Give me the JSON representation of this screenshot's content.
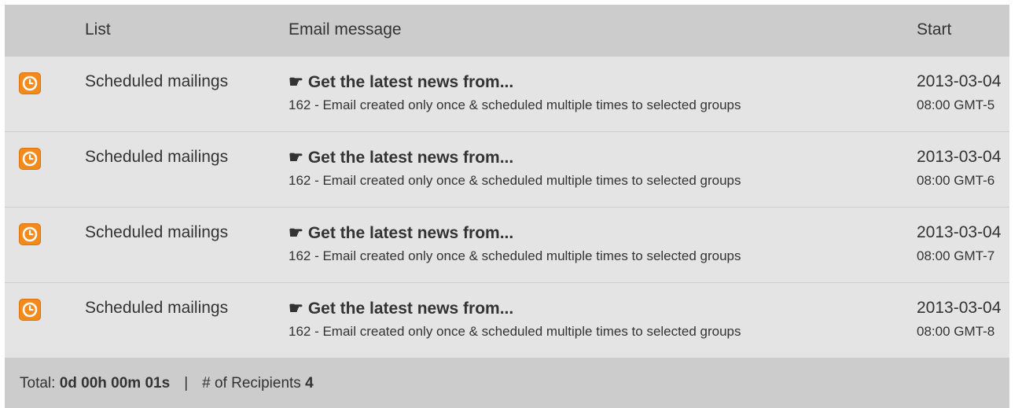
{
  "header": {
    "list": "List",
    "email_message": "Email message",
    "start": "Start"
  },
  "rows": [
    {
      "icon": "clock-icon",
      "list": "Scheduled mailings",
      "title_glyph": "☛",
      "title": "Get the latest news from...",
      "subtitle": "162 - Email created only once & scheduled multiple times to selected groups",
      "start_date": "2013-03-04",
      "start_time": "08:00 GMT-5"
    },
    {
      "icon": "clock-icon",
      "list": "Scheduled mailings",
      "title_glyph": "☛",
      "title": "Get the latest news from...",
      "subtitle": "162 - Email created only once & scheduled multiple times to selected groups",
      "start_date": "2013-03-04",
      "start_time": "08:00 GMT-6"
    },
    {
      "icon": "clock-icon",
      "list": "Scheduled mailings",
      "title_glyph": "☛",
      "title": "Get the latest news from...",
      "subtitle": "162 - Email created only once & scheduled multiple times to selected groups",
      "start_date": "2013-03-04",
      "start_time": "08:00 GMT-7"
    },
    {
      "icon": "clock-icon",
      "list": "Scheduled mailings",
      "title_glyph": "☛",
      "title": "Get the latest news from...",
      "subtitle": "162 - Email created only once & scheduled multiple times to selected groups",
      "start_date": "2013-03-04",
      "start_time": "08:00 GMT-8"
    }
  ],
  "footer": {
    "total_label": "Total:",
    "total_value": "0d 00h 00m 01s",
    "separator": "|",
    "recipients_label": "# of Recipients",
    "recipients_value": "4"
  },
  "colors": {
    "header_bg": "#cccccc",
    "row_bg": "#e4e4e4",
    "icon_accent": "#f28a1c"
  }
}
